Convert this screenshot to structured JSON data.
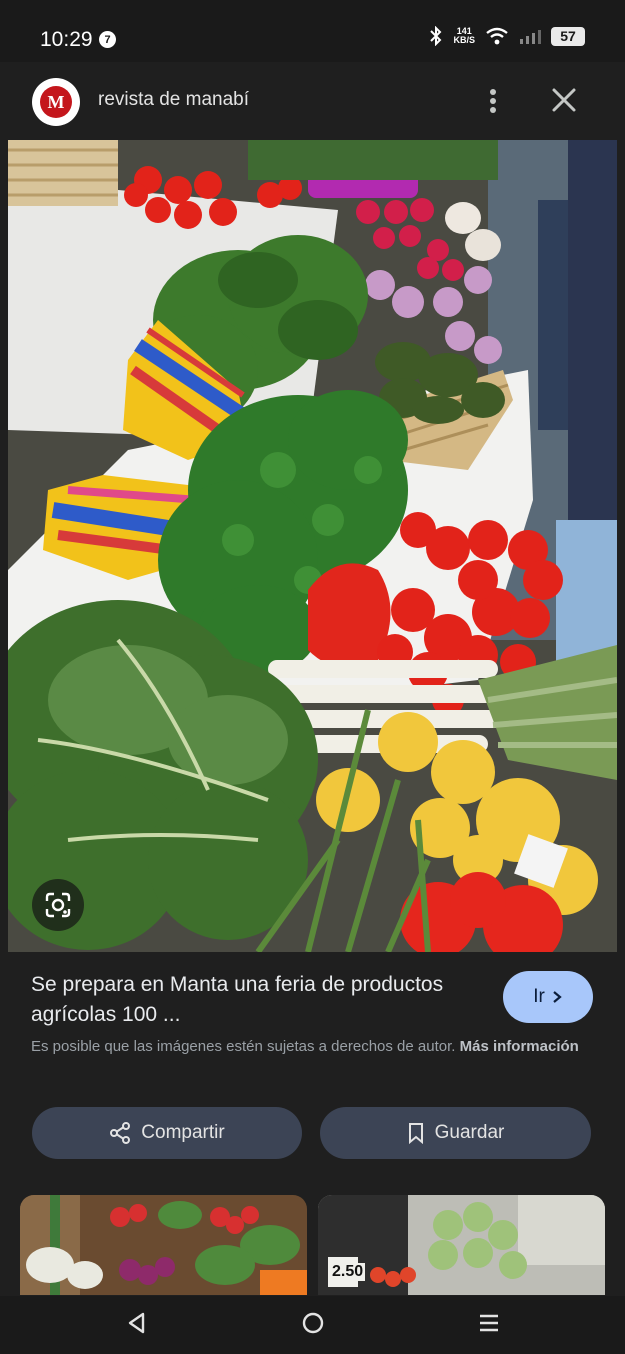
{
  "status": {
    "time": "10:29",
    "notification_count": "7",
    "speed_top": "141",
    "speed_bottom": "KB/S",
    "battery": "57"
  },
  "header": {
    "logo_text": "M",
    "site_name": "revista de manabí",
    "more_icon": "more-vert-icon",
    "close_icon": "close-icon"
  },
  "photo": {
    "subject": "farmers-market produce stall",
    "lens_icon": "google-lens-icon"
  },
  "result": {
    "title": "Se prepara en Manta una feria de productos agrícolas 100 ...",
    "go_label": "Ir",
    "notice_text": "Es posible que las imágenes estén sujetas a derechos de autor.",
    "notice_link": "Más información"
  },
  "actions": {
    "share_label": "Compartir",
    "save_label": "Guardar"
  },
  "related": {
    "thumb2_price": "2.50"
  },
  "colors": {
    "background": "#1f1f1f",
    "go_button": "#a8c7fa",
    "pill_button": "#3c4455"
  }
}
